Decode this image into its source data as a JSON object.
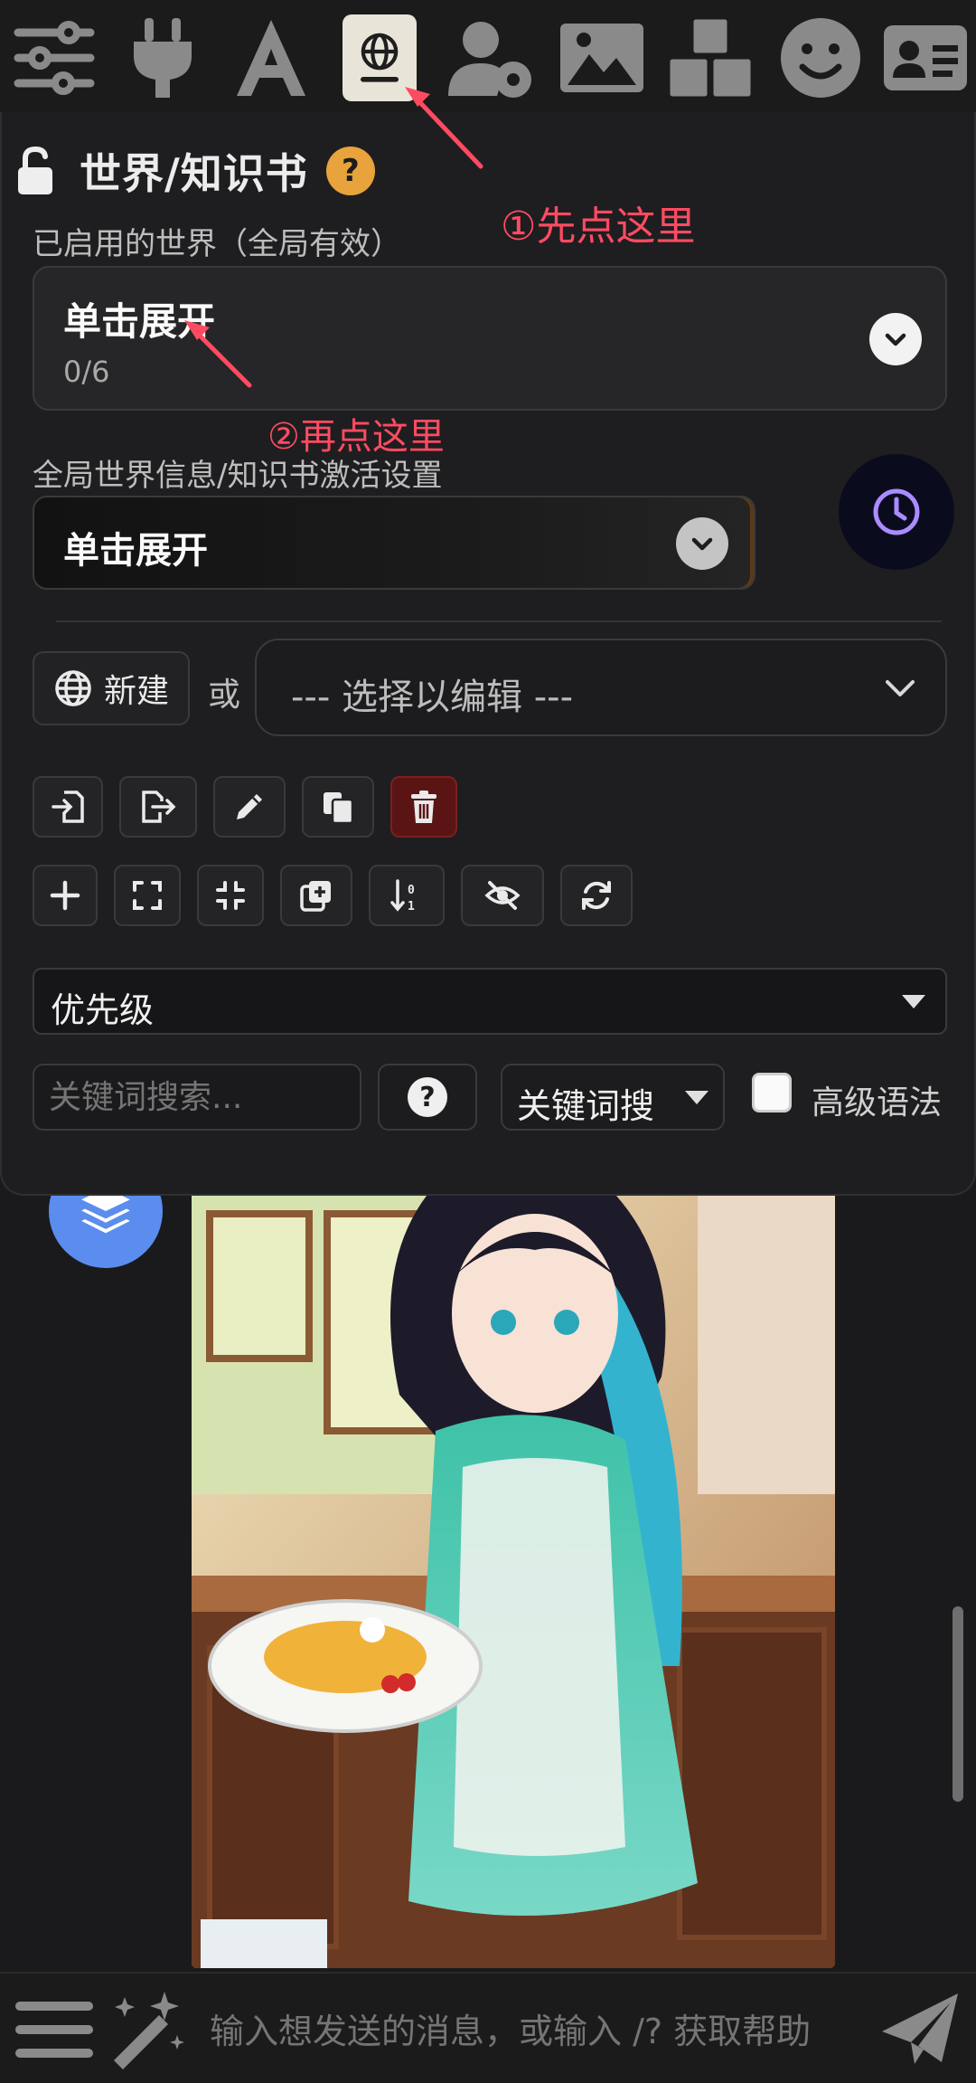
{
  "topbar": {
    "icons": [
      "sliders-icon",
      "plug-icon",
      "font-icon",
      "book-globe-icon",
      "user-cog-icon",
      "image-icon",
      "cubes-icon",
      "smile-icon",
      "id-card-icon"
    ],
    "active_index": 3
  },
  "panel": {
    "title": "世界/知识书",
    "help_badge": "?",
    "active_worlds_label": "已启用的世界（全局有效）",
    "active_worlds_toggle": "单击展开",
    "active_worlds_count": "0/6",
    "activation_settings_label": "全局世界信息/知识书激活设置",
    "activation_settings_toggle": "单击展开",
    "new_button": "新建",
    "or_text": "或",
    "select_placeholder": "--- 选择以编辑 ---",
    "row1_tools": [
      "import-icon",
      "export-icon",
      "rename-icon",
      "duplicate-icon",
      "delete-icon"
    ],
    "row2_tools": [
      "add-entry-icon",
      "expand-all-icon",
      "collapse-all-icon",
      "fill-memo-icon",
      "sort-icon",
      "hide-icon",
      "refresh-icon"
    ],
    "sort_value": "优先级",
    "search_placeholder": "关键词搜索...",
    "search_help": "?",
    "search_mode": "关键词搜",
    "advanced_syntax_label": "高级语法"
  },
  "annotations": {
    "step1": "①先点这里",
    "step2": "②再点这里"
  },
  "bottombar": {
    "message_placeholder": "输入想发送的消息，或输入 /? 获取帮助"
  },
  "colors": {
    "annotation": "#ff4b62",
    "accent_blue": "#5b8def",
    "help_orange": "#e8a33c",
    "danger": "#5a1414"
  }
}
